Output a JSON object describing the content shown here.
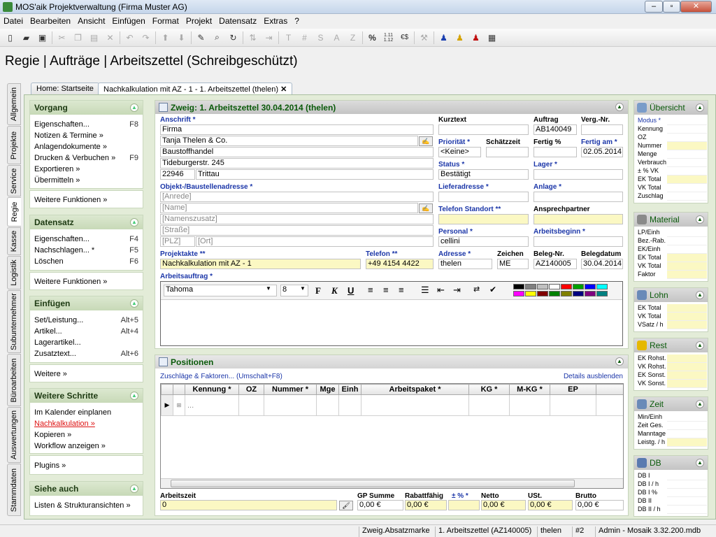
{
  "window": {
    "title": "MOS'aik Projektverwaltung (Firma Muster AG)",
    "min": "–",
    "max": "▫",
    "close": "✕"
  },
  "menu": [
    "Datei",
    "Bearbeiten",
    "Ansicht",
    "Einfügen",
    "Format",
    "Projekt",
    "Datensatz",
    "Extras",
    "?"
  ],
  "toolbar_glyphs": {
    "t": "T",
    "hash": "#",
    "s": "S",
    "a": "A",
    "z": "Z",
    "percent": "%",
    "ratio": "1.11 1.12",
    "euro": "€$"
  },
  "page_title": "Regie | Aufträge | Arbeitszettel (Schreibgeschützt)",
  "vtabs": [
    "Allgemein",
    "Projekte",
    "Service",
    "Regie",
    "Kasse",
    "Logistik",
    "Subunternehmer",
    "Büroarbeiten",
    "Auswertungen",
    "Stammdaten"
  ],
  "doctabs": {
    "home": "Home: Startseite",
    "active": "Nachkalkulation mit AZ - 1 - 1. Arbeitszettel (thelen)",
    "close": "✕"
  },
  "left": {
    "vorgang": {
      "title": "Vorgang",
      "items": [
        {
          "label": "Eigenschaften...",
          "key": "F8"
        },
        {
          "label": "Notizen & Termine »",
          "key": ""
        },
        {
          "label": "Anlagendokumente »",
          "key": ""
        },
        {
          "label": "Drucken & Verbuchen »",
          "key": "F9"
        },
        {
          "label": "Exportieren »",
          "key": ""
        },
        {
          "label": "Übermitteln »",
          "key": ""
        }
      ],
      "more": "Weitere Funktionen »"
    },
    "datensatz": {
      "title": "Datensatz",
      "items": [
        {
          "label": "Eigenschaften...",
          "key": "F4"
        },
        {
          "label": "Nachschlagen... *",
          "key": "F5"
        },
        {
          "label": "Löschen",
          "key": "F6"
        }
      ],
      "more": "Weitere Funktionen »"
    },
    "einfuegen": {
      "title": "Einfügen",
      "items": [
        {
          "label": "Set/Leistung...",
          "key": "Alt+5"
        },
        {
          "label": "Artikel...",
          "key": "Alt+4"
        },
        {
          "label": "Lagerartikel...",
          "key": ""
        },
        {
          "label": "Zusatztext...",
          "key": "Alt+6"
        }
      ],
      "more": "Weitere »"
    },
    "schritte": {
      "title": "Weitere Schritte",
      "items": [
        "Im Kalender einplanen",
        "Nachkalkulation »",
        "Kopieren »",
        "Workflow anzeigen »"
      ],
      "more": "Plugins »"
    },
    "siehe": {
      "title": "Siehe auch",
      "items": [
        "Listen & Strukturansichten »"
      ]
    }
  },
  "form": {
    "title": "Zweig: 1. Arbeitszettel 30.04.2014 (thelen)",
    "anschrift_label": "Anschrift *",
    "anschrift": [
      "Firma",
      "Tanja Thelen & Co.",
      "Baustoffhandel",
      "Tideburgerstr. 245"
    ],
    "plz": "22946",
    "ort": "Trittau",
    "objekt_label": "Objekt-/Baustellenadresse *",
    "objekt": [
      "[Anrede]",
      "[Name]",
      "[Namenszusatz]",
      "[Straße]"
    ],
    "objekt_plz": "[PLZ]",
    "objekt_ort": "[Ort]",
    "projektakte_label": "Projektakte **",
    "projektakte": "Nachkalkulation mit AZ - 1",
    "telefon_label": "Telefon **",
    "telefon": "+49 4154 4422",
    "kurztext_label": "Kurztext",
    "auftrag_label": "Auftrag",
    "auftrag": "AB140049",
    "vergnr_label": "Verg.-Nr.",
    "prioritaet_label": "Priorität *",
    "prioritaet": "<Keine>",
    "schaetzzeit_label": "Schätzzeit",
    "fertigp_label": "Fertig %",
    "fertigam_label": "Fertig am *",
    "fertigam": "02.05.2014",
    "status_label": "Status *",
    "status": "Bestätigt",
    "lager_label": "Lager *",
    "lieferadresse_label": "Lieferadresse *",
    "anlage_label": "Anlage *",
    "telstandort_label": "Telefon Standort **",
    "ansprechpartner_label": "Ansprechpartner",
    "personal_label": "Personal *",
    "personal": "cellini",
    "arbeitsbeginn_label": "Arbeitsbeginn *",
    "adresse_label": "Adresse *",
    "adresse": "thelen",
    "zeichen_label": "Zeichen",
    "zeichen": "ME",
    "belegnr_label": "Beleg-Nr.",
    "belegnr": "AZ140005",
    "belegdatum_label": "Belegdatum",
    "belegdatum": "30.04.2014",
    "arbeitsauftrag_label": "Arbeitsauftrag *",
    "font": "Tahoma",
    "size": "8",
    "palette": [
      "#000000",
      "#808080",
      "#c0c0c0",
      "#ffffff",
      "#ff0000",
      "#00a000",
      "#0000ff",
      "#00ffff",
      "#ff00ff",
      "#ffff00",
      "#800000",
      "#008000",
      "#808000",
      "#000080",
      "#800080",
      "#008080"
    ]
  },
  "positionen": {
    "title": "Positionen",
    "zuschlaege": "Zuschläge & Faktoren... (Umschalt+F8)",
    "details": "Details ausblenden",
    "columns": [
      "Kennung *",
      "OZ",
      "Nummer *",
      "Mge",
      "Einh",
      "Arbeitspaket *",
      "KG *",
      "M-KG *",
      "EP"
    ],
    "row_placeholder": "...",
    "arbeitszeit_label": "Arbeitszeit",
    "arbeitszeit": "0",
    "sums": [
      {
        "label": "GP Summe",
        "value": "0,00 €"
      },
      {
        "label": "Rabattfähig",
        "value": "0,00 €"
      },
      {
        "label": "± % *",
        "value": ""
      },
      {
        "label": "Netto",
        "value": "0,00 €"
      },
      {
        "label": "USt.",
        "value": "0,00 €"
      },
      {
        "label": "Brutto",
        "value": "0,00 €"
      }
    ]
  },
  "right": {
    "uebersicht": {
      "title": "Übersicht",
      "rows": [
        {
          "l": "Modus *",
          "y": false
        },
        {
          "l": "Kennung",
          "y": false
        },
        {
          "l": "OZ",
          "y": false
        },
        {
          "l": "Nummer",
          "y": true
        },
        {
          "l": "Menge",
          "y": false
        },
        {
          "l": "Verbrauch",
          "y": false
        },
        {
          "l": "± % VK",
          "y": false
        },
        {
          "l": "EK Total",
          "y": true
        },
        {
          "l": "VK Total",
          "y": false
        },
        {
          "l": "Zuschlag",
          "y": false
        }
      ]
    },
    "material": {
      "title": "Material",
      "rows": [
        {
          "l": "LP/Einh",
          "y": false
        },
        {
          "l": "Bez.-Rab.",
          "y": false
        },
        {
          "l": "EK/Einh",
          "y": false
        },
        {
          "l": "EK Total",
          "y": true
        },
        {
          "l": "VK Total",
          "y": true
        },
        {
          "l": "Faktor",
          "y": true
        }
      ]
    },
    "lohn": {
      "title": "Lohn",
      "rows": [
        {
          "l": "EK Total",
          "y": true
        },
        {
          "l": "VK Total",
          "y": true
        },
        {
          "l": "VSatz / h",
          "y": true
        }
      ]
    },
    "rest": {
      "title": "Rest",
      "rows": [
        {
          "l": "EK Rohst.",
          "y": true
        },
        {
          "l": "VK Rohst.",
          "y": true
        },
        {
          "l": "EK Sonst.",
          "y": true
        },
        {
          "l": "VK Sonst.",
          "y": true
        }
      ]
    },
    "zeit": {
      "title": "Zeit",
      "rows": [
        {
          "l": "Min/Einh",
          "y": false
        },
        {
          "l": "Zeit Ges.",
          "y": false
        },
        {
          "l": "Manntage",
          "y": false
        },
        {
          "l": "Leistg. / h",
          "y": true
        }
      ]
    },
    "db": {
      "title": "DB",
      "rows": [
        {
          "l": "DB I",
          "y": false
        },
        {
          "l": "DB I / h",
          "y": false
        },
        {
          "l": "DB I %",
          "y": false
        },
        {
          "l": "DB II",
          "y": false
        },
        {
          "l": "DB II / h",
          "y": false
        }
      ]
    }
  },
  "status": [
    "Zweig.Absatzmarke",
    "1. Arbeitszettel (AZ140005)",
    "thelen",
    "#2",
    "Admin - Mosaik 3.32.200.mdb"
  ]
}
